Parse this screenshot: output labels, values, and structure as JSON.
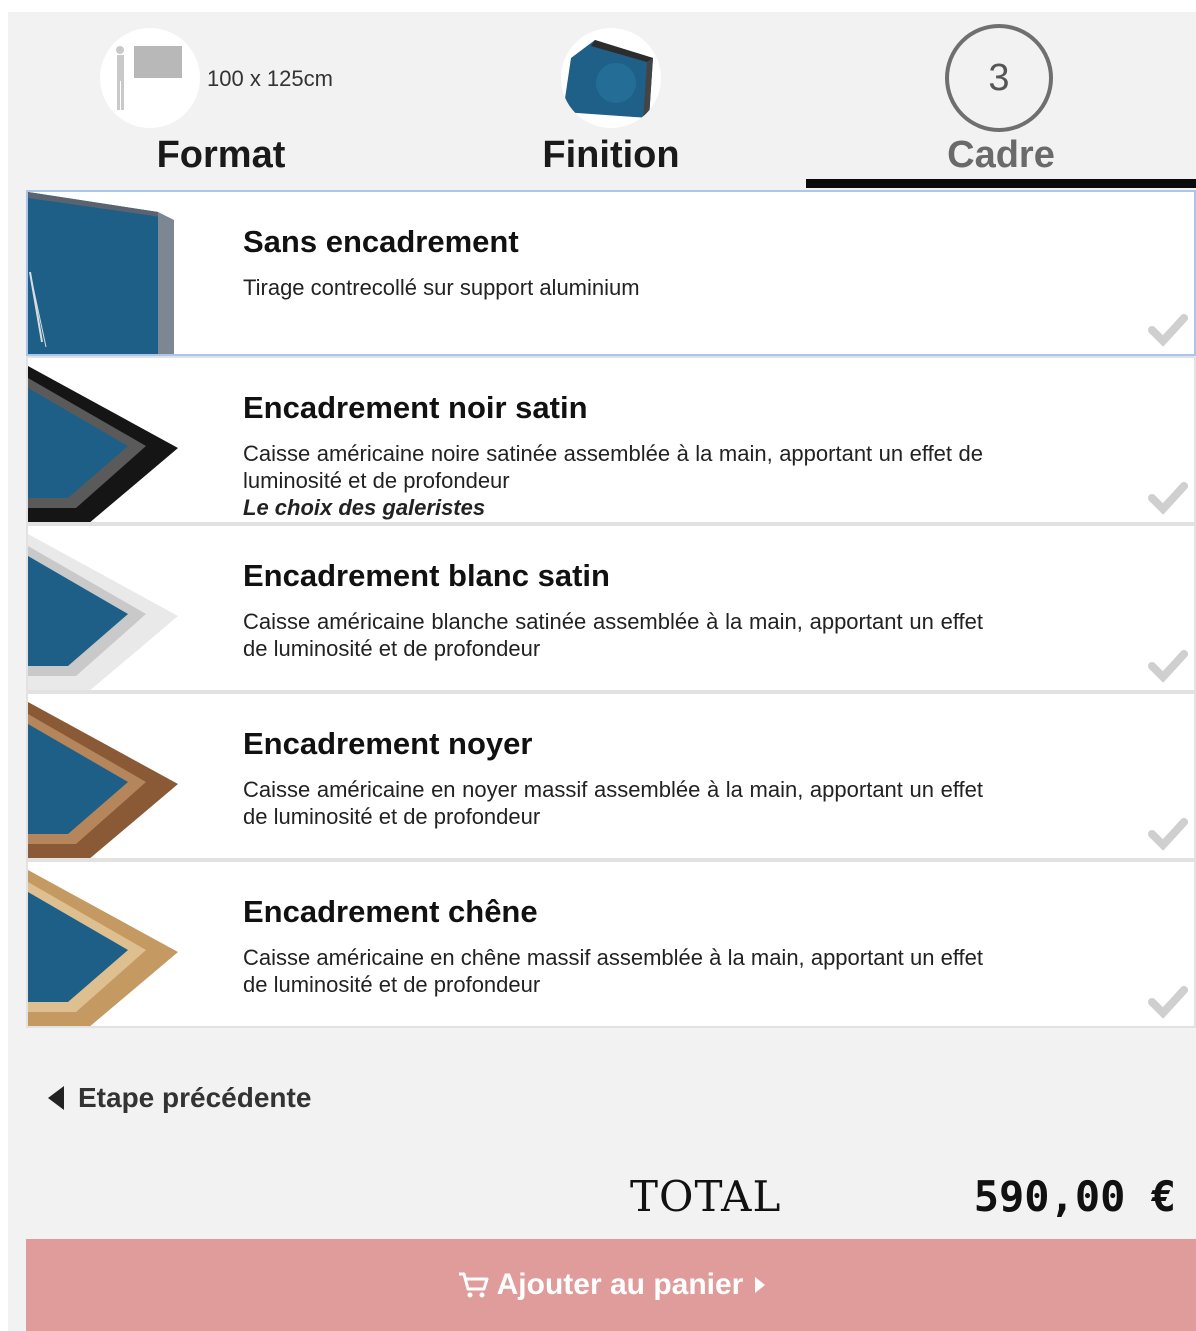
{
  "steps": [
    {
      "label": "Format",
      "detail": "100 x 125cm"
    },
    {
      "label": "Finition"
    },
    {
      "label": "Cadre",
      "number": "3",
      "active": true
    }
  ],
  "options": [
    {
      "title": "Sans encadrement",
      "description": "Tirage contrecollé sur support aluminium",
      "tagline": "",
      "frame_color": "#9aa6b2",
      "selected": true
    },
    {
      "title": "Encadrement noir satin",
      "description": "Caisse américaine noire satinée assemblée à la main, apportant un effet de luminosité et de profondeur",
      "tagline": "Le choix des galeristes",
      "frame_color": "#151515",
      "selected": false
    },
    {
      "title": "Encadrement blanc satin",
      "description": "Caisse américaine blanche satinée assemblée à la main, apportant un effet de luminosité et de profondeur",
      "tagline": "",
      "frame_color": "#f4f4f4",
      "selected": false
    },
    {
      "title": "Encadrement noyer",
      "description": "Caisse américaine en noyer massif assemblée à la main, apportant un effet de luminosité et de profondeur",
      "tagline": "",
      "frame_color": "#8a5a36",
      "selected": false
    },
    {
      "title": "Encadrement chêne",
      "description": "Caisse américaine en chêne massif assemblée à la main, apportant un effet de luminosité et de profondeur",
      "tagline": "",
      "frame_color": "#c49a62",
      "selected": false
    }
  ],
  "nav": {
    "previous_label": "Etape précédente"
  },
  "total": {
    "label": "TOTAL",
    "value": "590,00 €"
  },
  "cart_button": {
    "label": "Ajouter au panier"
  },
  "colors": {
    "accent": "#e09b9b",
    "selected_border": "#a9c7ec",
    "photo_blue": "#1d5f86"
  }
}
